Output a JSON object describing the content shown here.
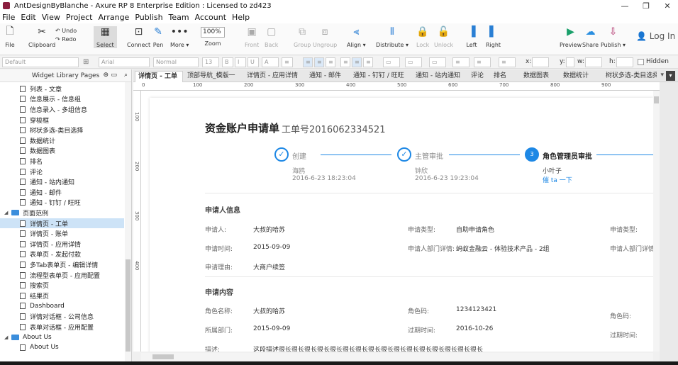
{
  "window": {
    "title": "AntDesignByBlanche - Axure RP 8 Enterprise Edition : Licensed to zd423",
    "minimize": "—",
    "restore": "❐",
    "close": "✕"
  },
  "menu": [
    "File",
    "Edit",
    "View",
    "Project",
    "Arrange",
    "Publish",
    "Team",
    "Account",
    "Help"
  ],
  "toolbar": {
    "file": "File",
    "clipboard": "Clipboard",
    "undo": "Undo",
    "redo": "Redo",
    "select": "Select",
    "connect": "Connect",
    "pen": "Pen",
    "more": "More ▾",
    "zoom_value": "100%",
    "zoom_label": "Zoom",
    "front": "Front",
    "back": "Back",
    "group": "Group",
    "ungroup": "Ungroup",
    "align": "Align ▾",
    "distribute": "Distribute ▾",
    "lock": "Lock",
    "unlock": "Unlock",
    "left": "Left",
    "right": "Right",
    "preview": "Preview",
    "share": "Share",
    "publish": "Publish ▾",
    "login": "Log In"
  },
  "formatbar": {
    "style": "Default",
    "font": "Arial",
    "weight": "Normal",
    "size": "13",
    "x": "x:",
    "y": "y:",
    "w": "w:",
    "h": "h:",
    "hidden": "Hidden"
  },
  "panel": {
    "title": "Widget Library Pages"
  },
  "tree": [
    {
      "label": "列表 - 文章",
      "kind": "page",
      "indent": 1
    },
    {
      "label": "信息展示 - 信息组",
      "kind": "page",
      "indent": 1
    },
    {
      "label": "信息录入 - 多组信息",
      "kind": "page",
      "indent": 1
    },
    {
      "label": "穿梭框",
      "kind": "page",
      "indent": 1
    },
    {
      "label": "树状多选-类目选择",
      "kind": "page",
      "indent": 1
    },
    {
      "label": "数据统计",
      "kind": "page",
      "indent": 1
    },
    {
      "label": "数据图表",
      "kind": "page",
      "indent": 1
    },
    {
      "label": "排名",
      "kind": "page",
      "indent": 1
    },
    {
      "label": "评论",
      "kind": "page",
      "indent": 1
    },
    {
      "label": "通知 - 站内通知",
      "kind": "page",
      "indent": 1
    },
    {
      "label": "通知 - 邮件",
      "kind": "page",
      "indent": 1
    },
    {
      "label": "通知 - 钉钉 / 旺旺",
      "kind": "page",
      "indent": 1
    },
    {
      "label": "页面范例",
      "kind": "folder",
      "indent": 0
    },
    {
      "label": "详情页 - 工单",
      "kind": "page",
      "indent": 1,
      "selected": true
    },
    {
      "label": "详情页 - 账单",
      "kind": "page",
      "indent": 1
    },
    {
      "label": "详情页 - 应用详情",
      "kind": "page",
      "indent": 1
    },
    {
      "label": "表单页 - 发起付款",
      "kind": "page",
      "indent": 1
    },
    {
      "label": "多Tab表单页 - 编辑详情",
      "kind": "page",
      "indent": 1
    },
    {
      "label": "流程型表单页 - 应用配置",
      "kind": "page",
      "indent": 1
    },
    {
      "label": "搜索页",
      "kind": "page",
      "indent": 1
    },
    {
      "label": "结果页",
      "kind": "page",
      "indent": 1
    },
    {
      "label": "Dashboard",
      "kind": "page",
      "indent": 1
    },
    {
      "label": "详情对话框 - 公司信息",
      "kind": "page",
      "indent": 1
    },
    {
      "label": "表单对话框 - 应用配置",
      "kind": "page",
      "indent": 1
    },
    {
      "label": "About Us",
      "kind": "folder",
      "indent": 0
    },
    {
      "label": "About Us",
      "kind": "page",
      "indent": 1
    }
  ],
  "tabs": [
    "详情页 - 工单",
    "顶部导航_模版一",
    "详情页 - 应用详情",
    "通知 - 邮件",
    "通知 - 钉钉 / 旺旺",
    "通知 - 站内通知",
    "评论",
    "排名",
    "数据图表",
    "数据统计",
    "树状多选-类目选择"
  ],
  "ruler": {
    "h": [
      "0",
      "100",
      "200",
      "300",
      "400",
      "500",
      "600",
      "700",
      "800",
      "900"
    ],
    "v": [
      "100",
      "200",
      "300",
      "400"
    ]
  },
  "doc": {
    "title": "资金账户申请单",
    "order": "工单号2016062334521",
    "steps": [
      {
        "name": "创建",
        "person": "海鸥",
        "time": "2016-6-23 18:23:04"
      },
      {
        "name": "主管审批",
        "person": "钟欣",
        "time": "2016-6-23  19:23:04"
      },
      {
        "name": "角色管理员审批",
        "person": "小叶子",
        "link": "催 ta 一下",
        "num": "3"
      }
    ],
    "check": "✓",
    "section1": "申请人信息",
    "applicant_label": "申请人:",
    "applicant": "大叔的哈苏",
    "apptype_label": "申请类型:",
    "apptype": "自助申请角色",
    "apptype_label2": "申请类型:",
    "time_label": "申请时间:",
    "time": "2015-09-09",
    "dept_label": "申请人部门详情:",
    "dept": "蚂蚁金融云 - 体验技术产品 - 2组",
    "dept_label2": "申请人部门详情:",
    "reason_label": "申请理由:",
    "reason": "大商户续签",
    "section2": "申请内容",
    "role_label": "角色名称:",
    "role": "大叔的哈苏",
    "rolecode_label": "角色码:",
    "rolecode": "1234123421",
    "rolecode_label2": "角色码:",
    "owndept_label": "所属部门:",
    "owndept": "2015-09-09",
    "expire_label": "过期时间:",
    "expire": "2016-10-26",
    "expire_label2": "过期时间:",
    "desc_label": "描述:",
    "desc": "这段描述很长很长很长很长很长很长很长很长很长很长很长很长很长很长很长很长"
  }
}
